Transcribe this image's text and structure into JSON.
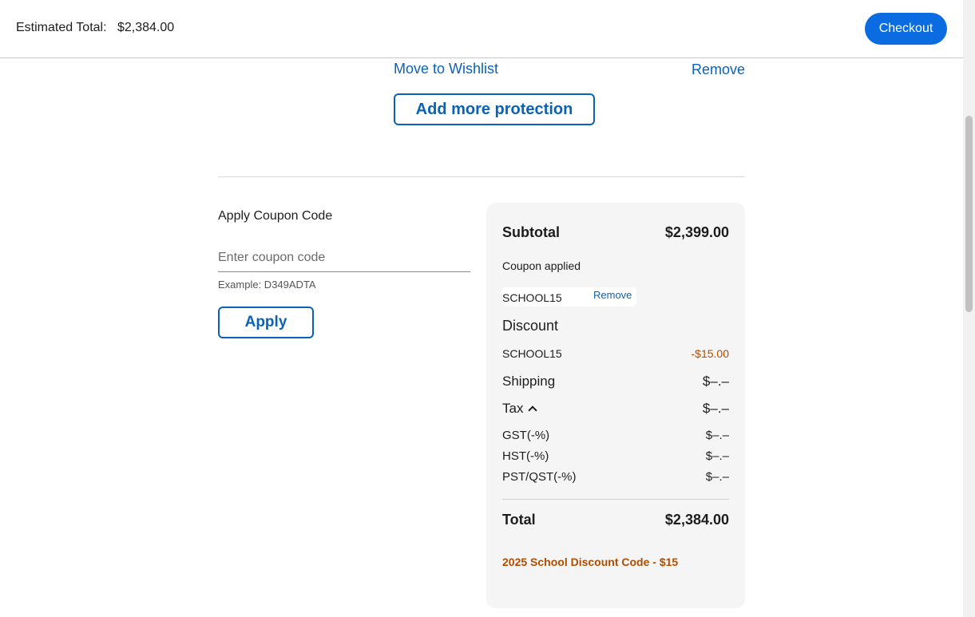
{
  "header": {
    "estimated_total_label": "Estimated Total:",
    "estimated_total_value": "$2,384.00",
    "checkout_label": "Checkout"
  },
  "item_actions": {
    "move_to_wishlist": "Move to Wishlist",
    "remove": "Remove",
    "add_protection": "Add more protection"
  },
  "coupon": {
    "title": "Apply Coupon Code",
    "placeholder": "Enter coupon code",
    "example": "Example: D349ADTA",
    "apply_label": "Apply"
  },
  "summary": {
    "subtotal_label": "Subtotal",
    "subtotal_value": "$2,399.00",
    "coupon_applied_label": "Coupon applied",
    "coupon_code": "SCHOOL15",
    "coupon_remove": "Remove",
    "discount_label": "Discount",
    "discount_code": "SCHOOL15",
    "discount_value": "-$15.00",
    "shipping_label": "Shipping",
    "shipping_value": "$–.–",
    "tax_label": "Tax",
    "tax_value": "$–.–",
    "tax_lines": [
      {
        "label": "GST(-%)",
        "value": "$–.–"
      },
      {
        "label": "HST(-%)",
        "value": "$–.–"
      },
      {
        "label": "PST/QST(-%)",
        "value": "$–.–"
      }
    ],
    "total_label": "Total",
    "total_value": "$2,384.00",
    "promo_text": "2025 School Discount Code - $15"
  },
  "colors": {
    "accent": "#0a6ce0",
    "link": "#0a62b8",
    "discount": "#b14c00"
  }
}
